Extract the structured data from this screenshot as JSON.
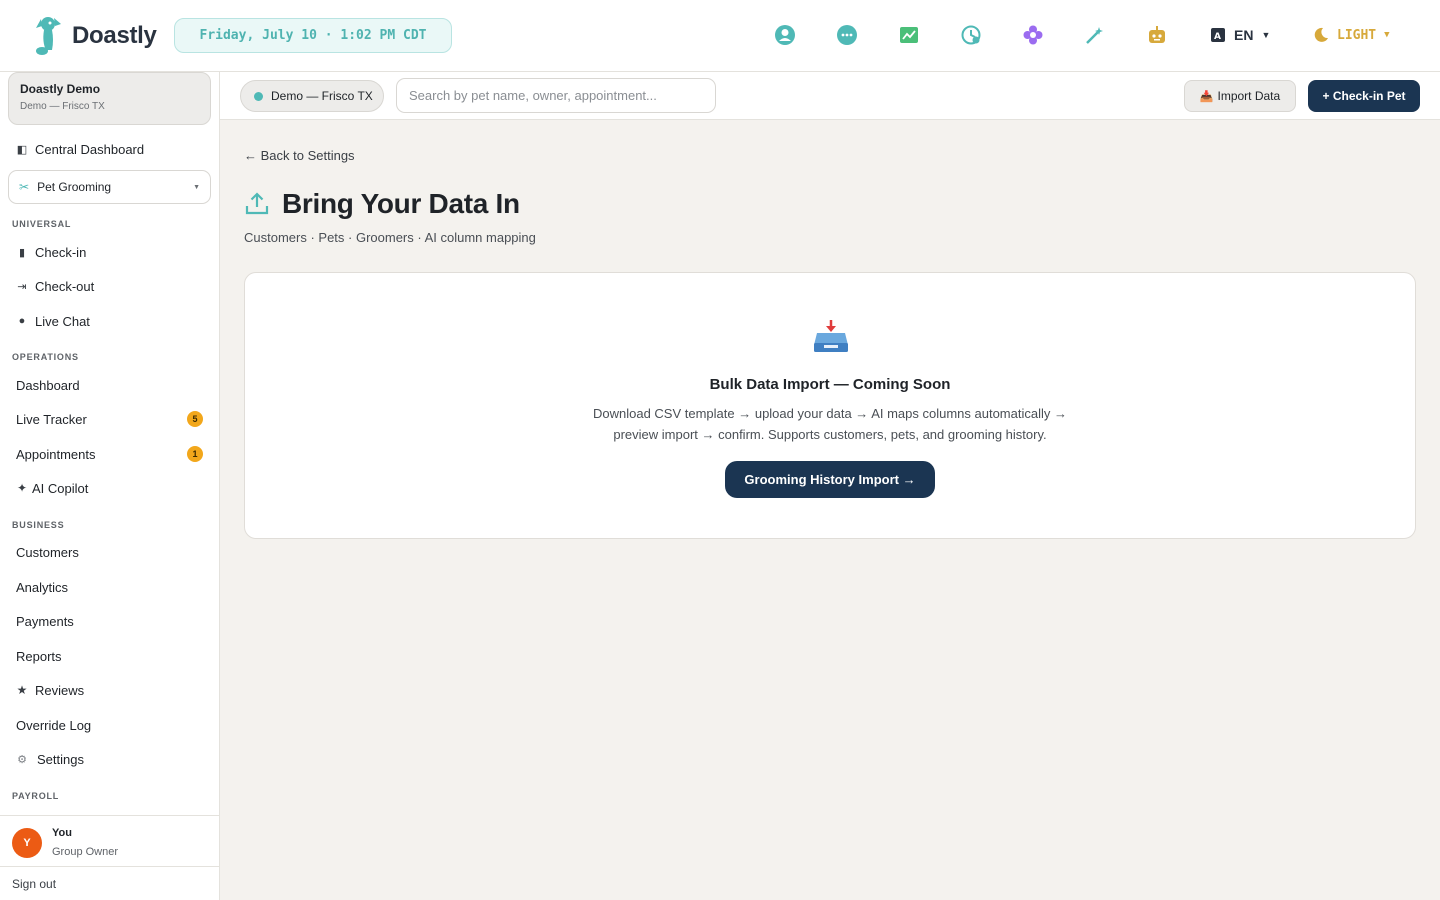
{
  "app": {
    "logo_text": "Doastly",
    "datetime": "Friday, July 10 · 1:02 PM CDT",
    "language": "EN",
    "theme": "LIGHT"
  },
  "topbar_icons": [
    "support-icon",
    "chat-icon",
    "chart-icon",
    "clock-icon",
    "flower-icon",
    "magic-wand-icon",
    "robot-icon"
  ],
  "colors": {
    "teal": "#4fb9b6",
    "navy": "#1b3552",
    "badge": "#f2a71b",
    "avatar": "#ec5b14",
    "theme_gold": "#d7a93b"
  },
  "sidebar": {
    "org_name": "Doastly Demo",
    "org_location": "Demo — Frisco TX",
    "central_dashboard": "Central Dashboard",
    "vertical_select": "Pet Grooming",
    "sections": {
      "universal": "UNIVERSAL",
      "operations": "OPERATIONS",
      "business": "BUSINESS",
      "payroll": "PAYROLL"
    },
    "universal_items": [
      "Check-in",
      "Check-out",
      "Live Chat"
    ],
    "operations_items": [
      {
        "label": "Dashboard",
        "badge": ""
      },
      {
        "label": "Live Tracker",
        "badge": "5"
      },
      {
        "label": "Appointments",
        "badge": "1"
      },
      {
        "label": "AI Copilot",
        "badge": ""
      }
    ],
    "business_items": [
      "Customers",
      "Analytics",
      "Payments",
      "Reports",
      "Reviews",
      "Override Log",
      "Settings"
    ],
    "user": {
      "initial": "Y",
      "name": "You",
      "role": "Group Owner"
    },
    "sign_out": "Sign out"
  },
  "subbar": {
    "location": "Demo — Frisco TX",
    "search_placeholder": "Search by pet name, owner, appointment...",
    "import_label": "Import Data",
    "checkin_label": "+ Check-in Pet"
  },
  "main": {
    "back_link": "← Back to Settings",
    "title": "Bring Your Data In",
    "subtitle": "Customers · Pets · Groomers · AI column mapping",
    "card": {
      "title": "Bulk Data Import — Coming Soon",
      "description_line1": "Download CSV template → upload your data → AI maps columns automatically →",
      "description_line2": "preview import → confirm. Supports customers, pets, and grooming history.",
      "button": "Grooming History Import →"
    }
  }
}
